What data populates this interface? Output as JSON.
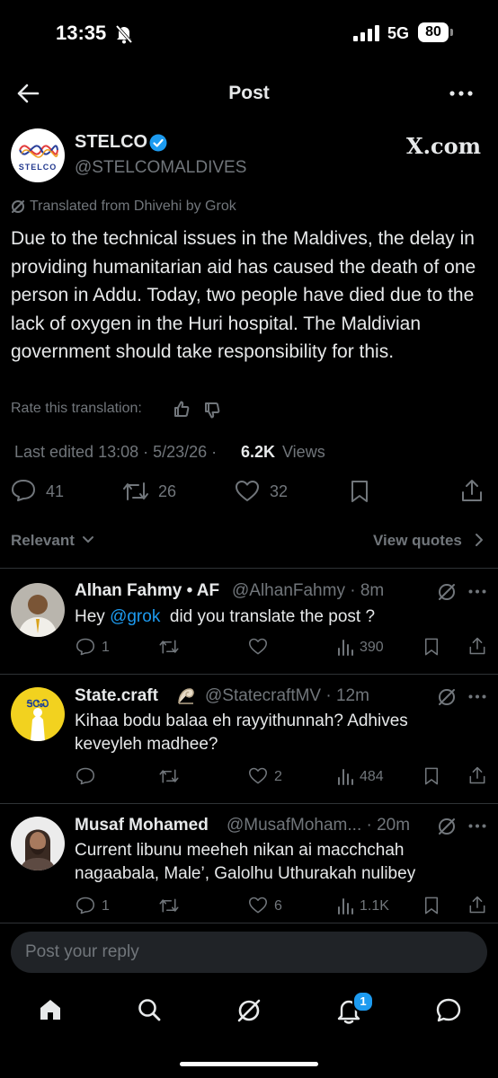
{
  "status_bar": {
    "time": "13:35",
    "network": "5G",
    "battery": "80"
  },
  "header": {
    "title": "Post"
  },
  "post": {
    "author_name": "STELCO",
    "author_handle": "@STELCOMALDIVES",
    "logo_text": "STELCO",
    "xcom_label": "X.com",
    "translated_note": "Translated from Dhivehi by Grok",
    "body": "Due to the technical issues in the Maldives, the delay in providing humanitarian aid has caused the death of one person in Addu. Today, two people have died due to the lack of oxygen in the Huri hospital. The Maldivian government should take responsibility for this.",
    "rate_label": "Rate this translation:",
    "edited": "Last edited 13:08 · 5/23/26 ·",
    "views_count": "6.2K",
    "views_label": "Views",
    "replies": "41",
    "reposts": "26",
    "likes": "32"
  },
  "sort": {
    "relevant": "Relevant",
    "view_quotes": "View quotes"
  },
  "replies": [
    {
      "name": "Alhan Fahmy • AF",
      "handle": "@AlhanFahmy · 8m",
      "text_before": "Hey ",
      "mention": "@grok",
      "text_after": "  did you translate the post ?",
      "replies": "1",
      "reposts": "",
      "likes": "",
      "views": "390"
    },
    {
      "name": "State.craft",
      "handle": "@StatecraftMV · 12m",
      "text": "Kihaa bodu balaa eh rayyithunnah? Adhives keveyleh madhee?",
      "replies": "",
      "reposts": "",
      "likes": "2",
      "views": "484"
    },
    {
      "name": "Musaf Mohamed",
      "handle": "@MusafMoham... · 20m",
      "text": "Current libunu meeheh nikan ai macchchah nagaabala, Male’, Galolhu Uthurakah nulibey",
      "replies": "1",
      "reposts": "",
      "likes": "6",
      "views": "1.1K"
    }
  ],
  "composer": {
    "placeholder": "Post your reply"
  },
  "tabbar": {
    "notification_badge": "1"
  },
  "colors": {
    "background": "#000000",
    "text": "#e7e9ea",
    "muted": "#71767b",
    "accent": "#1d9bf0",
    "divider": "#2f3336"
  }
}
